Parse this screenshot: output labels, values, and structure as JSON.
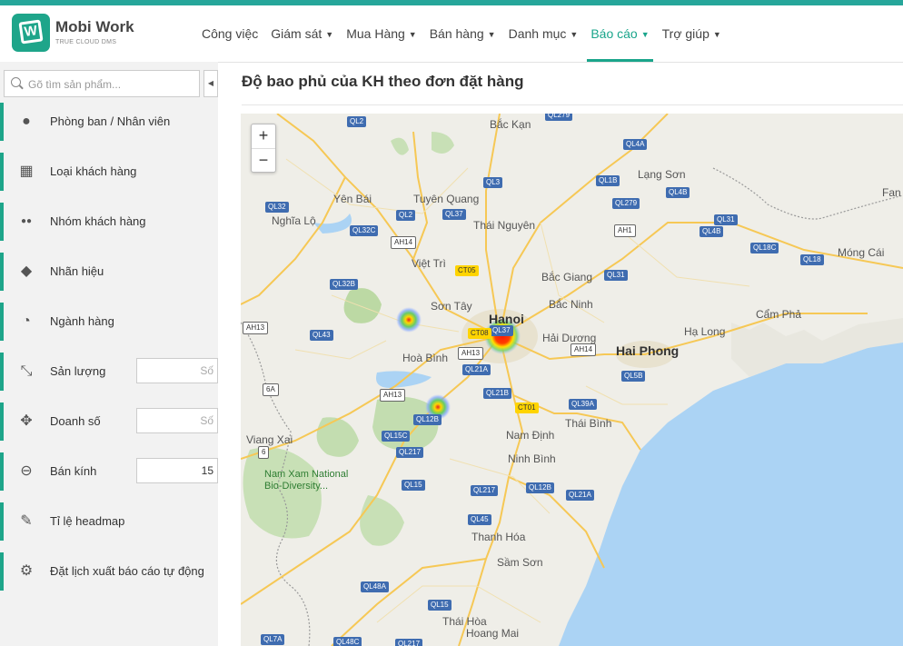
{
  "header": {
    "logo_letter": "W",
    "brand": "Mobi Work",
    "tagline": "TRUE CLOUD DMS",
    "nav": [
      {
        "label": "Công việc",
        "dropdown": false,
        "active": false
      },
      {
        "label": "Giám sát",
        "dropdown": true,
        "active": false
      },
      {
        "label": "Mua Hàng",
        "dropdown": true,
        "active": false
      },
      {
        "label": "Bán hàng",
        "dropdown": true,
        "active": false
      },
      {
        "label": "Danh mục",
        "dropdown": true,
        "active": false
      },
      {
        "label": "Báo cáo",
        "dropdown": true,
        "active": true
      },
      {
        "label": "Trợ giúp",
        "dropdown": true,
        "active": false
      }
    ],
    "caret": "▼"
  },
  "sidebar": {
    "search_placeholder": "Gõ tìm sản phẩm...",
    "collapse_icon": "◀",
    "items": [
      {
        "label": "Phòng ban / Nhân viên",
        "icon": "user-icon"
      },
      {
        "label": "Loại khách hàng",
        "icon": "grid-icon"
      },
      {
        "label": "Nhóm khách hàng",
        "icon": "users-icon"
      },
      {
        "label": "Nhãn hiệu",
        "icon": "tag-icon"
      },
      {
        "label": "Ngành hàng",
        "icon": "pie-chart-icon"
      },
      {
        "label": "Sản lượng",
        "icon": "compress-icon",
        "input_placeholder": "Số"
      },
      {
        "label": "Doanh số",
        "icon": "expand-icon",
        "input_placeholder": "Số"
      },
      {
        "label": "Bán kính",
        "icon": "minus-circle-icon",
        "input_value": "15"
      },
      {
        "label": "Tỉ lệ headmap",
        "icon": "edit-icon"
      },
      {
        "label": "Đặt lịch xuất báo cáo tự động",
        "icon": "gear-icon"
      }
    ]
  },
  "main": {
    "title": "Độ bao phủ của KH theo đơn đặt hàng",
    "zoom_in": "+",
    "zoom_out": "−"
  },
  "map": {
    "places": [
      "Bắc Kạn",
      "Lạng Sơn",
      "Yên Bái",
      "Tuyên Quang",
      "Nghĩa Lộ",
      "Thái Nguyên",
      "Fan",
      "Việt Trì",
      "Móng Cái",
      "Bắc Giang",
      "Sơn Tây",
      "Bắc Ninh",
      "Cẩm Phả",
      "Hạ Long",
      "Hải Dương",
      "Hoà Bình",
      "Thái Bình",
      "Viang Xai",
      "Nam Định",
      "Ninh Bình",
      "Thanh Hóa",
      "Sầm Sơn",
      "Thái Hòa",
      "Hoang Mai"
    ],
    "cities": [
      "Hanoi",
      "Hai Phong"
    ],
    "park": "Nam Xam National Bio-Diversity...",
    "roads": [
      "QL2",
      "QL279",
      "QL4A",
      "QL3",
      "QL1B",
      "QL4B",
      "QL32",
      "QL2",
      "QL37",
      "QL279",
      "AH1",
      "QL31",
      "QL32C",
      "AH14",
      "QL4B",
      "QL18C",
      "CT05",
      "QL18",
      "QL32B",
      "QL31",
      "QL37",
      "AH13",
      "CT08",
      "QL43",
      "AH13",
      "AH14",
      "QL5B",
      "QL21A",
      "6A",
      "AH13",
      "QL21B",
      "CT01",
      "QL39A",
      "QL12B",
      "QL15C",
      "QL217",
      "6",
      "QL15",
      "QL217",
      "QL12B",
      "QL21A",
      "QL45",
      "QL48A",
      "QL15",
      "QL7A",
      "QL48C",
      "QL217"
    ],
    "heat_points": [
      {
        "name": "Hanoi",
        "intensity": "high"
      },
      {
        "name": "Ba Vì",
        "intensity": "medium"
      },
      {
        "name": "Hoà Bình south",
        "intensity": "medium"
      }
    ]
  }
}
